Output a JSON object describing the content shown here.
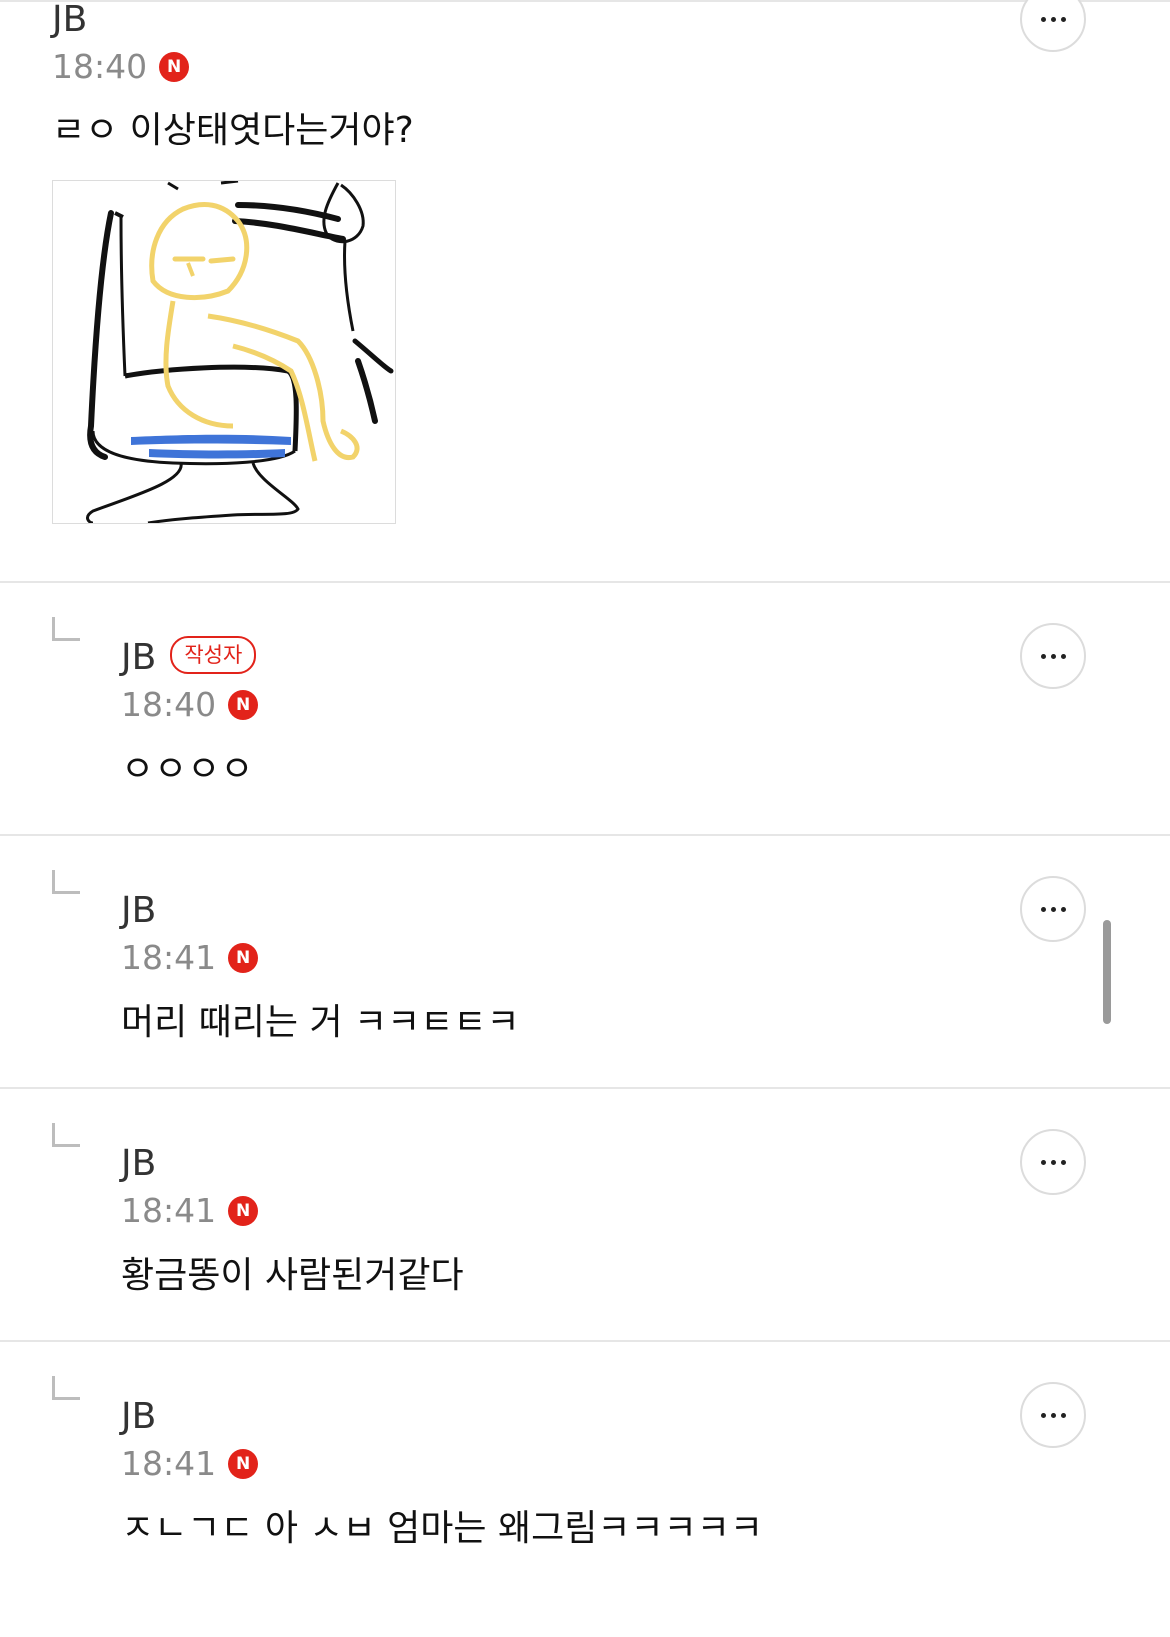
{
  "comments": [
    {
      "author": "JB",
      "time": "18:40",
      "new_badge": "N",
      "text": "ㄹㅇ 이상태엿다는거야?",
      "has_image": true
    },
    {
      "author": "JB",
      "writer_badge": "작성자",
      "time": "18:40",
      "new_badge": "N",
      "text": "ㅇㅇㅇㅇ",
      "is_reply": true
    },
    {
      "author": "JB",
      "time": "18:41",
      "new_badge": "N",
      "text": "머리 때리는 거 ㅋㅋㅌㅌㅋ",
      "is_reply": true
    },
    {
      "author": "JB",
      "time": "18:41",
      "new_badge": "N",
      "text": "황금똥이 사람된거같다",
      "is_reply": true
    },
    {
      "author": "JB",
      "time": "18:41",
      "new_badge": "N",
      "text": "ㅈㄴㄱㄷ 아 ㅅㅂ 엄마는 왜그림ㅋㅋㅋㅋㅋ",
      "is_reply": true
    }
  ],
  "icons": {
    "more": "more-options-icon",
    "reply": "reply-arrow-icon"
  },
  "colors": {
    "badge_red": "#e2231a",
    "divider": "#e6e6e6",
    "time_gray": "#8a8a8a"
  }
}
